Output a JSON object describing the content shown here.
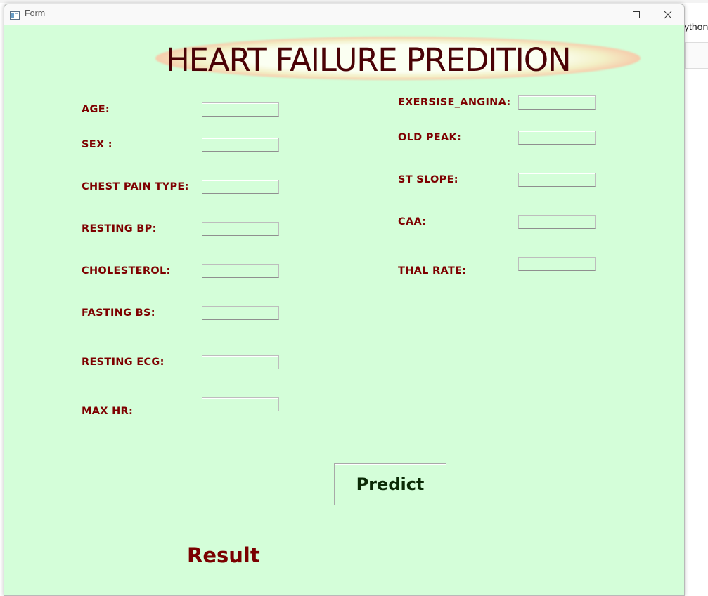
{
  "background": {
    "right_text": "ython"
  },
  "window": {
    "title": "Form",
    "controls": [
      "minimize",
      "maximize",
      "close"
    ]
  },
  "form": {
    "heading": "HEART FAILURE PREDITION",
    "left_fields": [
      {
        "label": "AGE:",
        "value": ""
      },
      {
        "label": "SEX :",
        "value": ""
      },
      {
        "label": "CHEST  PAIN  TYPE:",
        "value": ""
      },
      {
        "label": "RESTING  BP:",
        "value": ""
      },
      {
        "label": "CHOLESTEROL:",
        "value": ""
      },
      {
        "label": "FASTING  BS:",
        "value": ""
      },
      {
        "label": "RESTING  ECG:",
        "value": ""
      },
      {
        "label": "MAX  HR:",
        "value": ""
      }
    ],
    "right_fields": [
      {
        "label": "EXERSISE_ANGINA:",
        "value": ""
      },
      {
        "label": "OLD PEAK:",
        "value": ""
      },
      {
        "label": "ST  SLOPE:",
        "value": ""
      },
      {
        "label": "CAA:",
        "value": ""
      },
      {
        "label": "THAL  RATE:",
        "value": ""
      }
    ],
    "predict_button": "Predict",
    "result_text": "Result"
  },
  "colors": {
    "client_bg": "#d4fed9",
    "heading": "#4a0206",
    "label": "#7e0000",
    "button_text": "#0b2a06",
    "result": "#7a0000"
  }
}
